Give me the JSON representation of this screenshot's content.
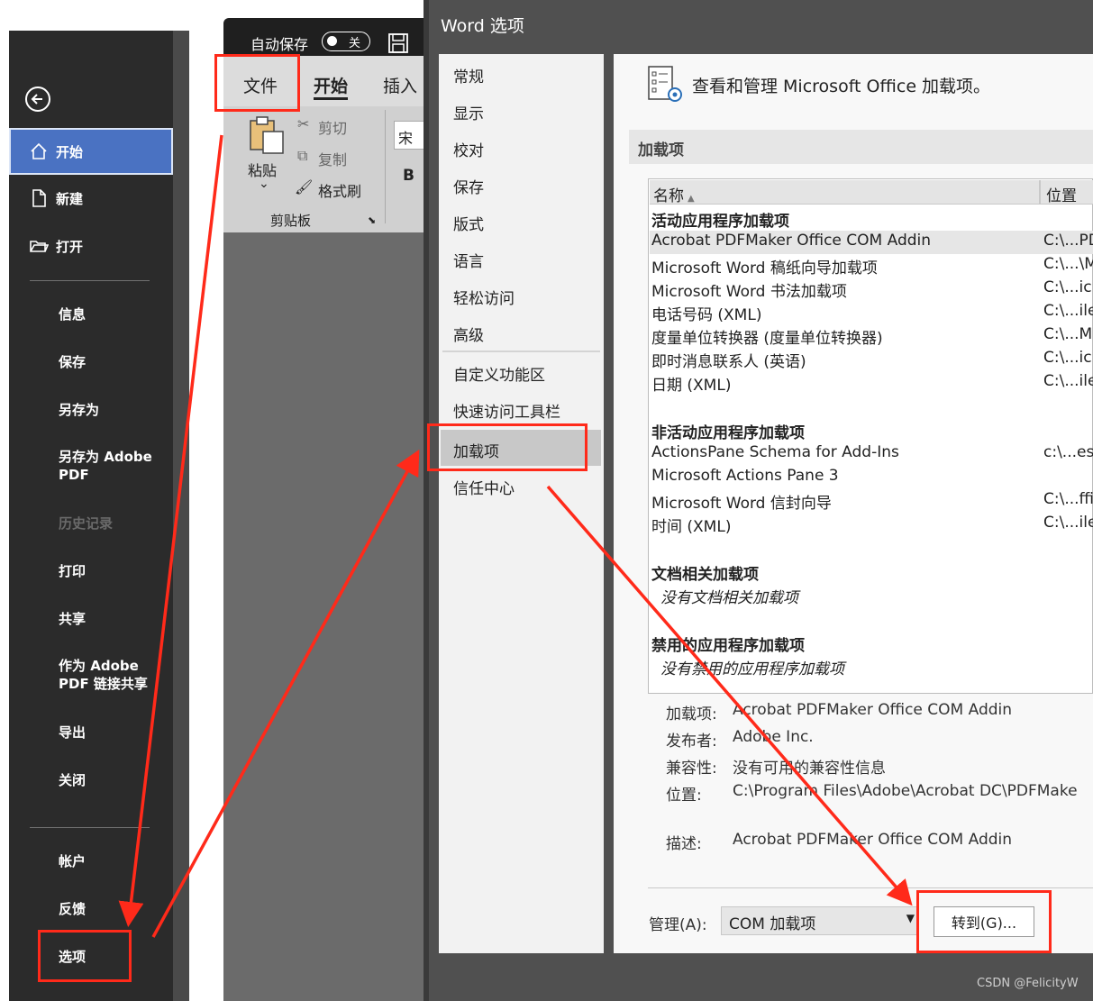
{
  "backstage": {
    "items": [
      {
        "label": "开始",
        "icon": "home-icon"
      },
      {
        "label": "新建",
        "icon": "new-doc-icon"
      },
      {
        "label": "打开",
        "icon": "folder-open-icon"
      },
      {
        "label": "信息"
      },
      {
        "label": "保存"
      },
      {
        "label": "另存为"
      },
      {
        "label": "另存为 Adobe PDF"
      },
      {
        "label": "历史记录"
      },
      {
        "label": "打印"
      },
      {
        "label": "共享"
      },
      {
        "label": "作为 Adobe PDF 链接共享"
      },
      {
        "label": "导出"
      },
      {
        "label": "关闭"
      },
      {
        "label": "帐户"
      },
      {
        "label": "反馈"
      },
      {
        "label": "选项"
      }
    ]
  },
  "word": {
    "autosave_label": "自动保存",
    "autosave_state": "关",
    "tabs": [
      "文件",
      "开始",
      "插入"
    ],
    "clipboard": {
      "paste": "粘贴",
      "cut": "剪切",
      "copy": "复制",
      "format_painter": "格式刷",
      "group": "剪贴板"
    },
    "font_box": "宋体",
    "bold": "B"
  },
  "dialog": {
    "title": "Word 选项",
    "nav": [
      "常规",
      "显示",
      "校对",
      "保存",
      "版式",
      "语言",
      "轻松访问",
      "高级",
      "自定义功能区",
      "快速访问工具栏",
      "加载项",
      "信任中心"
    ],
    "header": "查看和管理 Microsoft Office 加载项。",
    "section": "加载项",
    "columns": [
      "名称",
      "位置"
    ],
    "groups": {
      "active": "活动应用程序加载项",
      "inactive": "非活动应用程序加载项",
      "document": "文档相关加载项",
      "disabled": "禁用的应用程序加载项"
    },
    "active_items": [
      {
        "name": "Acrobat PDFMaker Office COM Addin",
        "loc": "C:\\...PD"
      },
      {
        "name": "Microsoft Word 稿纸向导加载项",
        "loc": "C:\\...\\M"
      },
      {
        "name": "Microsoft Word 书法加载项",
        "loc": "C:\\...icr"
      },
      {
        "name": "电话号码 (XML)",
        "loc": "C:\\...ile"
      },
      {
        "name": "度量单位转换器 (度量单位转换器)",
        "loc": "C:\\...MI"
      },
      {
        "name": "即时消息联系人 (英语)",
        "loc": "C:\\...icr"
      },
      {
        "name": "日期 (XML)",
        "loc": "C:\\...ile"
      }
    ],
    "inactive_items": [
      {
        "name": "ActionsPane Schema for Add-Ins",
        "loc": "c:\\...es\\"
      },
      {
        "name": "Microsoft Actions Pane 3",
        "loc": ""
      },
      {
        "name": "Microsoft Word 信封向导",
        "loc": "C:\\...ffic"
      },
      {
        "name": "时间 (XML)",
        "loc": "C:\\...ile"
      }
    ],
    "no_document": "没有文档相关加载项",
    "no_disabled": "没有禁用的应用程序加载项",
    "details": {
      "addin_label": "加载项:",
      "addin_value": "Acrobat PDFMaker Office COM Addin",
      "publisher_label": "发布者:",
      "publisher_value": "Adobe Inc.",
      "compat_label": "兼容性:",
      "compat_value": "没有可用的兼容性信息",
      "location_label": "位置:",
      "location_value": "C:\\Program Files\\Adobe\\Acrobat DC\\PDFMake",
      "desc_label": "描述:",
      "desc_value": "Acrobat PDFMaker Office COM Addin"
    },
    "manage_label": "管理(A):",
    "manage_value": "COM 加载项",
    "goto_button": "转到(G)..."
  },
  "watermark": "CSDN @FelicityW",
  "colors": {
    "highlight": "#ff2a1a",
    "backstage_bg": "#2b2b2b",
    "selected_item": "#4a72c2"
  }
}
